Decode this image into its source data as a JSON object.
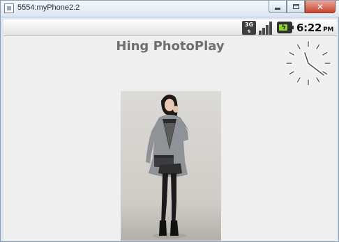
{
  "window": {
    "title": "5554:myPhone2.2",
    "minimize_icon": "minimize-icon",
    "maximize_icon": "maximize-icon",
    "close_icon": "close-icon",
    "close_glyph": "✕"
  },
  "statusbar": {
    "network_label": "3G",
    "time": "6:22",
    "ampm": "PM",
    "icons": [
      "3g-data-icon",
      "signal-strength-icon",
      "battery-charging-icon"
    ]
  },
  "app": {
    "title": "Hing PhotoPlay"
  },
  "colors": {
    "screen_bg": "#efefef",
    "title_text": "#6f6f6f",
    "battery_fill": "#8ed12a",
    "coat": "#8f9296"
  }
}
